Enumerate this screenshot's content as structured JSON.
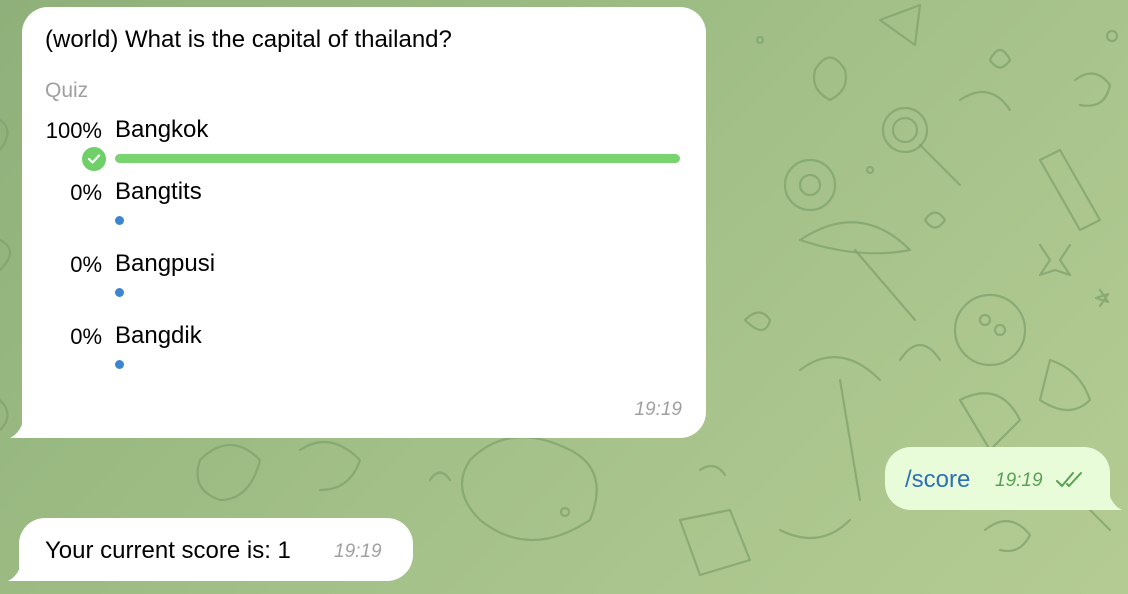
{
  "poll": {
    "question": "(world) What is the capital of thailand?",
    "type_label": "Quiz",
    "time": "19:19",
    "options": [
      {
        "percent": "100%",
        "label": "Bangkok",
        "fraction": 1.0,
        "correct": true
      },
      {
        "percent": "0%",
        "label": "Bangtits",
        "fraction": 0.0,
        "correct": false
      },
      {
        "percent": "0%",
        "label": "Bangpusi",
        "fraction": 0.0,
        "correct": false
      },
      {
        "percent": "0%",
        "label": "Bangdik",
        "fraction": 0.0,
        "correct": false
      }
    ]
  },
  "outgoing": {
    "text": "/score",
    "time": "19:19",
    "status_icon": "double-check-icon"
  },
  "reply": {
    "text": "Your current score is: 1",
    "time": "19:19"
  },
  "colors": {
    "bar_correct": "#79d46f",
    "dot_vote": "#3d85d0",
    "outgoing_bubble": "#e8fcd9",
    "command_link": "#2f6fba"
  }
}
